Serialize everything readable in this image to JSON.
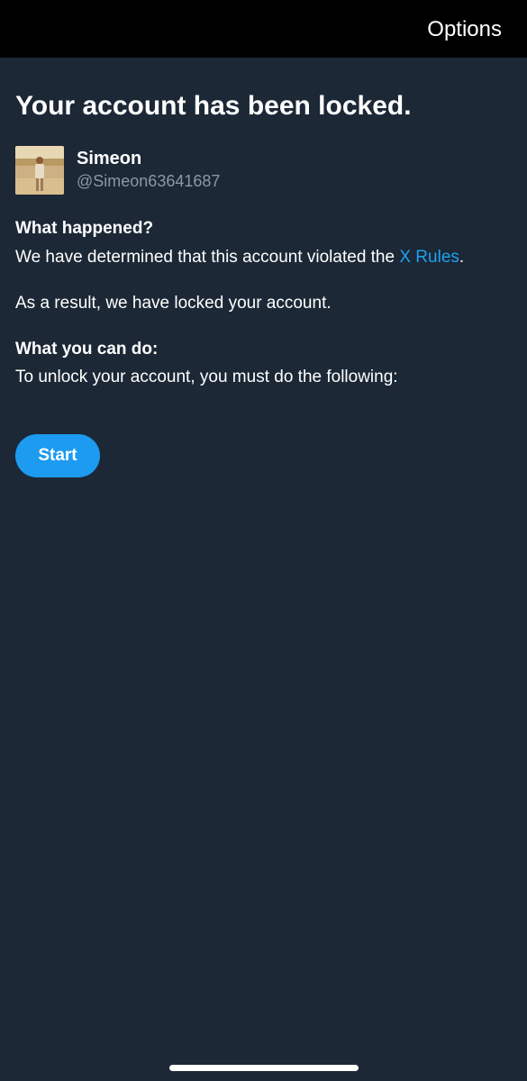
{
  "header": {
    "options_label": "Options"
  },
  "title": "Your account has been locked.",
  "profile": {
    "name": "Simeon",
    "handle": "@Simeon63641687"
  },
  "what_happened": {
    "heading": "What happened?",
    "text_before_link": "We have determined that this account violated the ",
    "link_text": "X Rules",
    "text_after_link": ".",
    "result_text": "As a result, we have locked your account."
  },
  "what_you_can_do": {
    "heading": "What you can do:",
    "text": "To unlock your account, you must do the following:"
  },
  "start_button_label": "Start",
  "colors": {
    "background": "#1c2836",
    "top_bar": "#000000",
    "link": "#1da1f2",
    "button": "#1d9bf0",
    "secondary_text": "#8899a6"
  }
}
